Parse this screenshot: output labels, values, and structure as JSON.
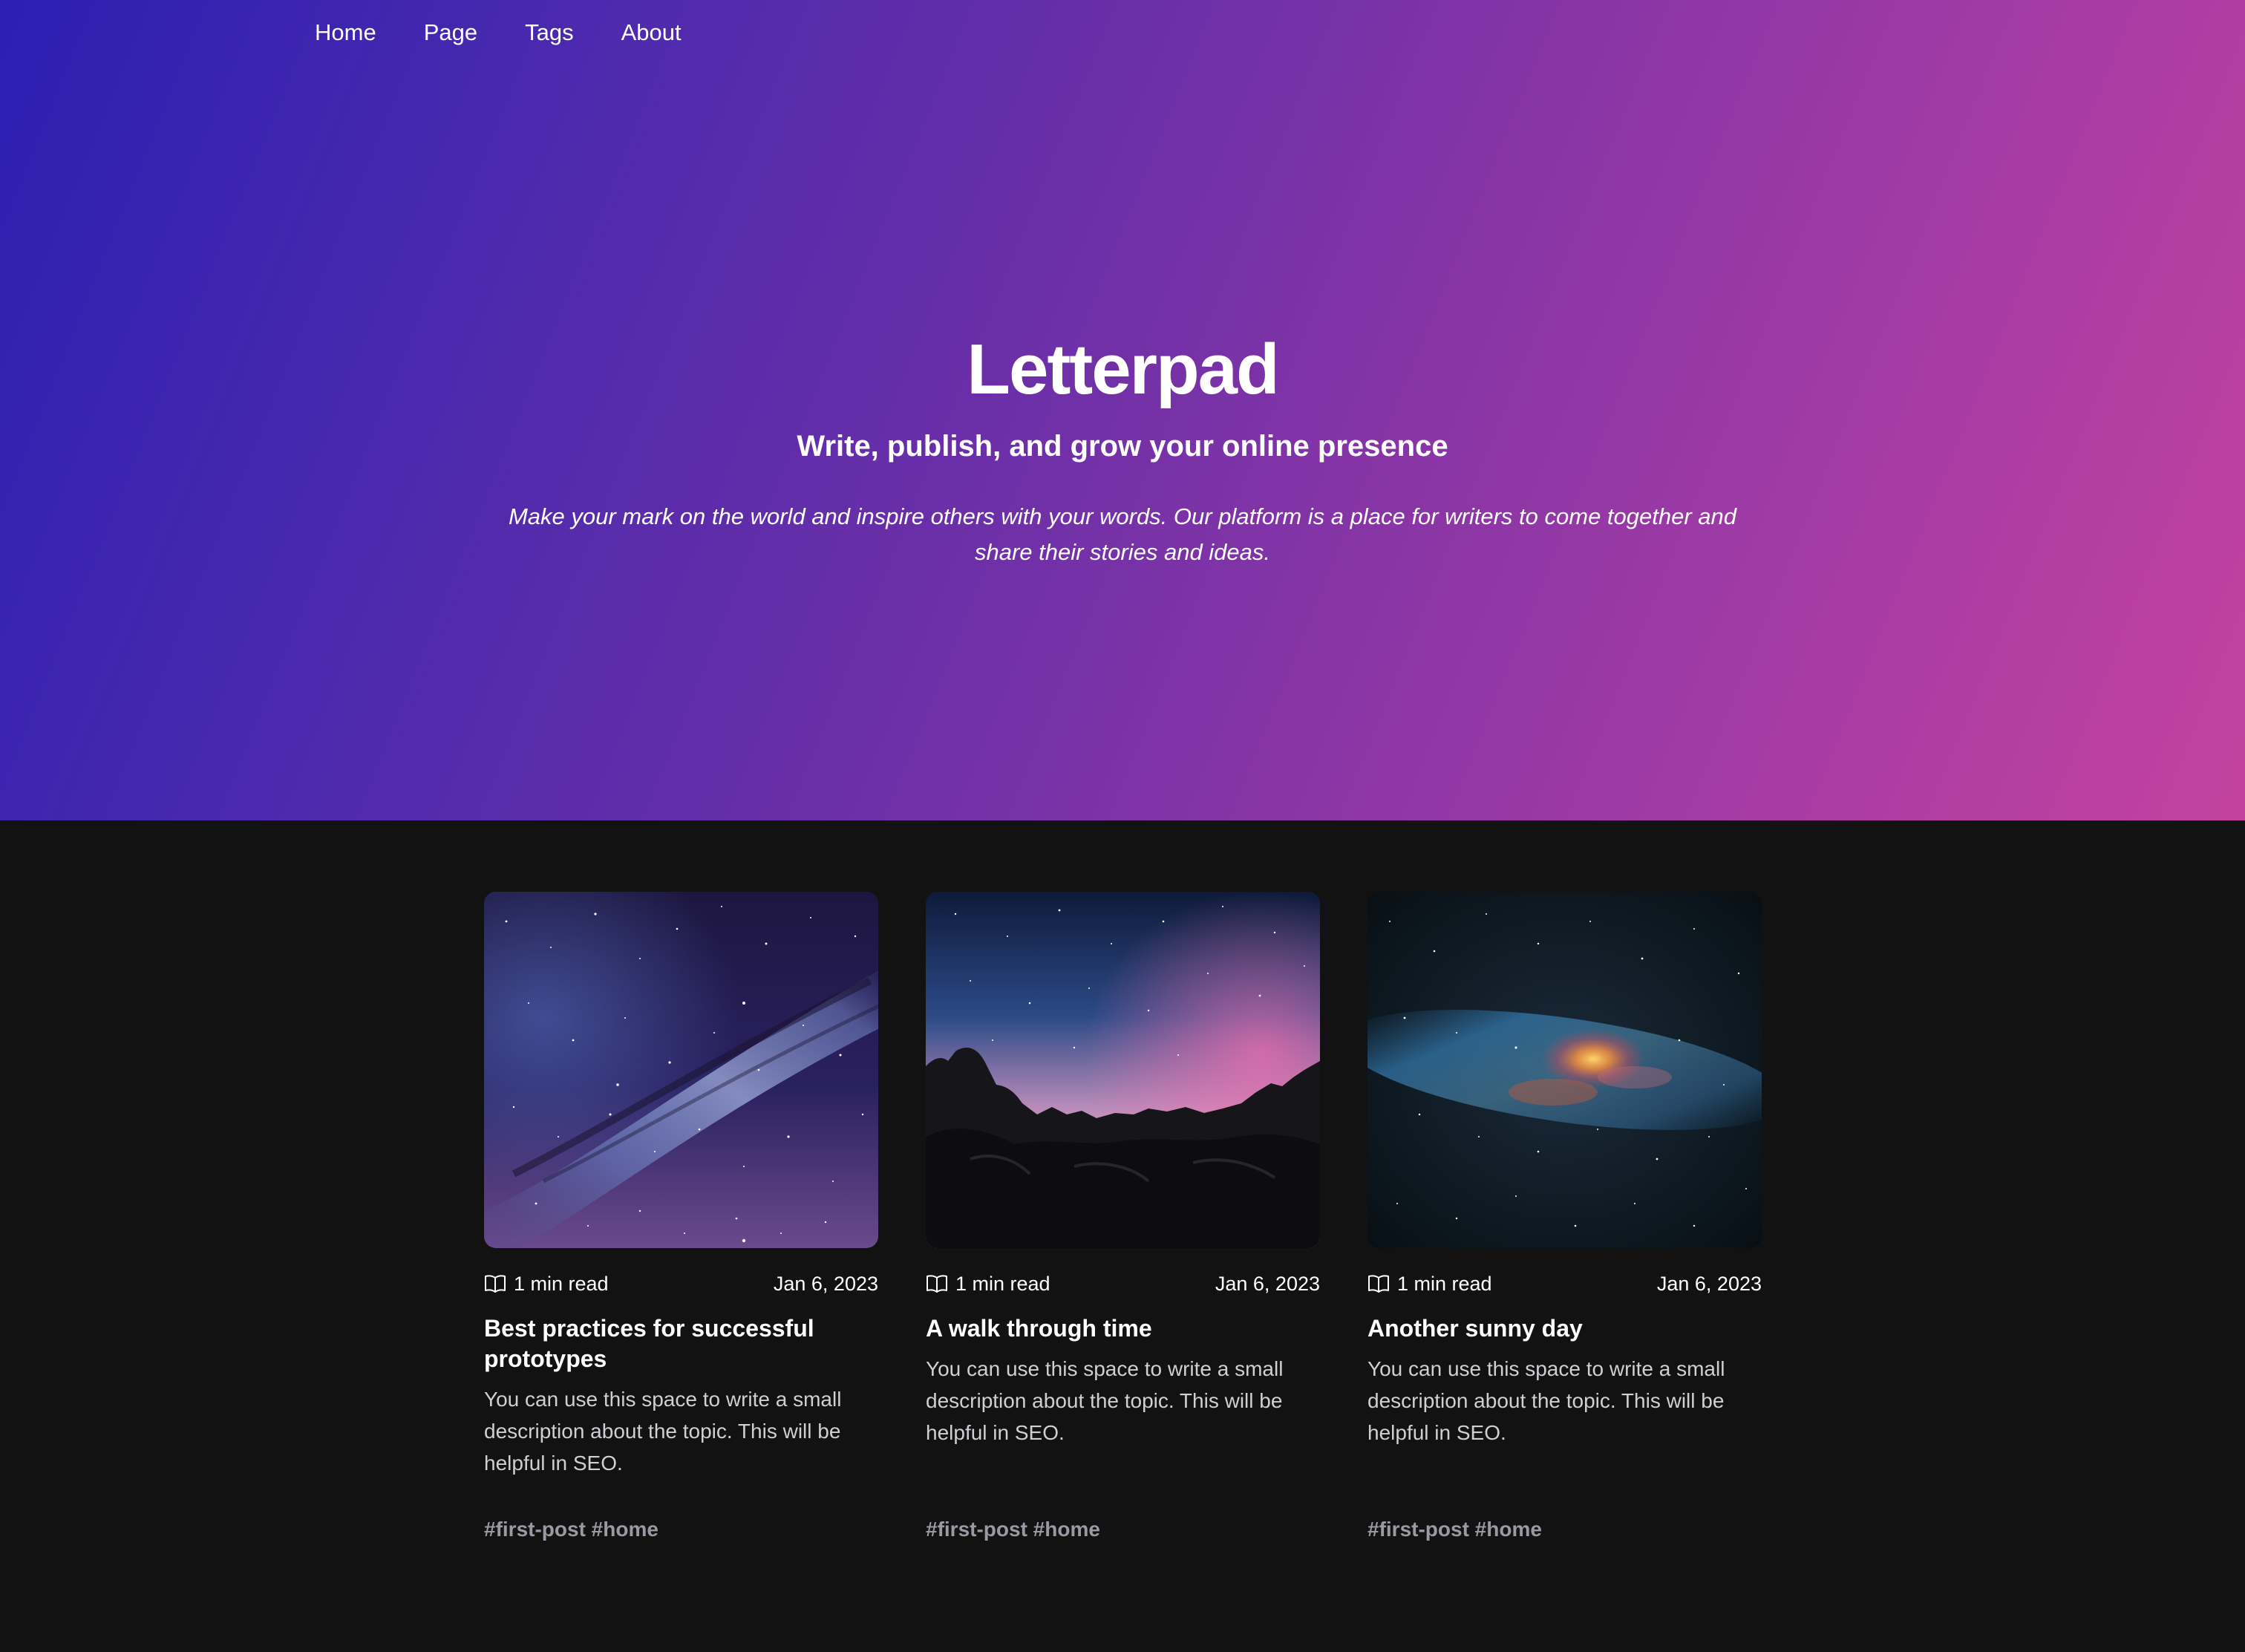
{
  "nav": {
    "items": [
      {
        "label": "Home"
      },
      {
        "label": "Page"
      },
      {
        "label": "Tags"
      },
      {
        "label": "About"
      }
    ]
  },
  "hero": {
    "title": "Letterpad",
    "subtitle": "Write, publish, and grow your online presence",
    "description": "Make your mark on the world and inspire others with your words. Our platform is a place for writers to come together and share their stories and ideas.",
    "gradient_colors": [
      "#2b1fb2",
      "#6b2fa8",
      "#c4429f"
    ]
  },
  "colors": {
    "page_background": "#121212",
    "text_primary": "#ffffff",
    "text_secondary": "#cfcfd4",
    "tag_color": "#9a9aa3"
  },
  "posts": [
    {
      "image_desc": "milky-way-galaxy-image",
      "icon": "book-icon",
      "read_time": "1 min read",
      "date": "Jan 6, 2023",
      "title": "Best practices for successful prototypes",
      "excerpt": "You can use this space to write a small description about the topic. This will be helpful in SEO.",
      "tags": "#first-post #home"
    },
    {
      "image_desc": "rocks-under-night-sky-image",
      "icon": "book-icon",
      "read_time": "1 min read",
      "date": "Jan 6, 2023",
      "title": "A walk through time",
      "excerpt": "You can use this space to write a small description about the topic. This will be helpful in SEO.",
      "tags": "#first-post #home"
    },
    {
      "image_desc": "colorful-nebula-image",
      "icon": "book-icon",
      "read_time": "1 min read",
      "date": "Jan 6, 2023",
      "title": "Another sunny day",
      "excerpt": "You can use this space to write a small description about the topic. This will be helpful in SEO.",
      "tags": "#first-post #home"
    }
  ]
}
